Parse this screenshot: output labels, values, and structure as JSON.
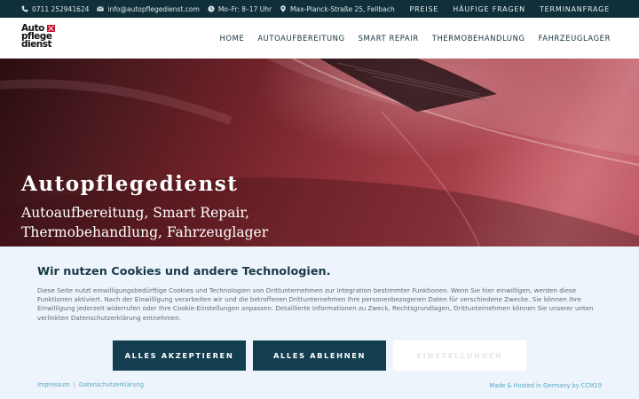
{
  "topbar": {
    "phone": "0711 252941624",
    "email": "info@autopflegedienst.com",
    "hours": "Mo–Fr: 8–17 Uhr",
    "address": "Max-Planck-Straße 25, Fellbach",
    "links": [
      "PREISE",
      "HÄUFIGE FRAGEN",
      "TERMINANFRAGE"
    ]
  },
  "logo": {
    "line1": "Auto",
    "line2": "pflege",
    "line3": "dienst"
  },
  "nav": [
    "HOME",
    "AUTOAUFBEREITUNG",
    "SMART REPAIR",
    "THERMOBEHANDLUNG",
    "FAHRZEUGLAGER"
  ],
  "hero": {
    "title": "Autopflegedienst",
    "subtitle_line1": "Autoaufbereitung, Smart Repair,",
    "subtitle_line2": "Thermobehandlung, Fahrzeuglager"
  },
  "cookie": {
    "title": "Wir nutzen Cookies und andere Technologien.",
    "text": "Diese Seite nutzt einwilligungsbedürftige Cookies und Technologien von Drittunternehmen zur Integration bestimmter Funktionen. Wenn Sie hier einwilligen, werden diese Funktionen aktiviert. Nach der Einwilligung verarbeiten wir und die betroffenen Drittunternehmen Ihre personenbezogenen Daten für verschiedene Zwecke. Sie können Ihre Einwilligung jederzeit widerrufen oder Ihre Cookie-Einstellungen anpassen. Detaillierte Informationen zu Zweck, Rechtsgrundlagen, Drittunternehmen können Sie unserer unten verlinkten Datenschutzerklärung entnehmen.",
    "accept_all": "ALLES AKZEPTIEREN",
    "reject_all": "ALLES ABLEHNEN",
    "settings": "EINSTELLUNGEN",
    "impressum": "Impressum",
    "separator": "|",
    "privacy": "Datenschutzerklärung",
    "hosted": "Made & Hosted in Germany by CCM19"
  },
  "colors": {
    "topbar_bg": "#0f2f3a",
    "button_primary": "#123e50",
    "banner_bg": "#eef4fb",
    "link": "#56a9c4",
    "logo_accent": "#c8102e"
  },
  "icons": [
    "phone-icon",
    "mail-icon",
    "clock-icon",
    "location-pin-icon"
  ]
}
